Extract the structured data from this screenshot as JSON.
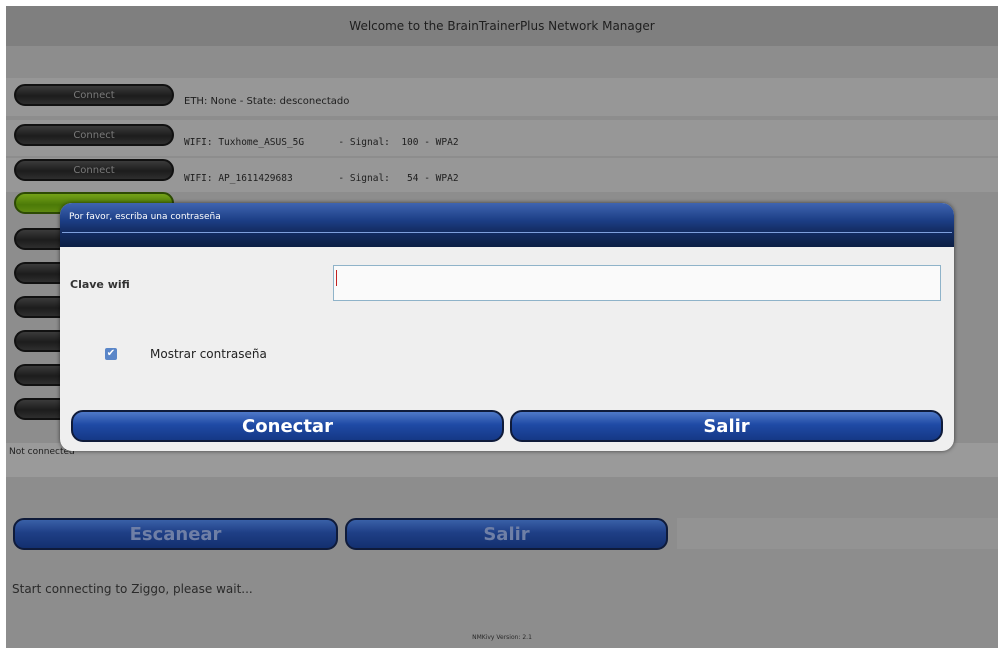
{
  "window": {
    "title": "Welcome to the BrainTrainerPlus Network Manager"
  },
  "networks": [
    {
      "button": "Connect",
      "info": "ETH: None - State: desconectado",
      "mono": false
    },
    {
      "button": "Connect",
      "info": "WIFI: Tuxhome_ASUS_5G      - Signal:  100 - WPA2",
      "mono": true
    },
    {
      "button": "Connect",
      "info": "WIFI: AP_1611429683        - Signal:   54 - WPA2",
      "mono": true
    }
  ],
  "status": "Not connected",
  "actions": {
    "scan_label": "Escanear",
    "exit_label": "Salir"
  },
  "message": "Start connecting to Ziggo, please wait...",
  "version": "NMKivy Version: 2.1",
  "dialog": {
    "title": "Por favor, escriba una contraseña",
    "field_label": "Clave wifi",
    "field_value": "",
    "show_password_label": "Mostrar contraseña",
    "show_password_checked": true,
    "connect_label": "Conectar",
    "exit_label": "Salir"
  },
  "colors": {
    "accent_blue": "#1f4aa5",
    "selected_green": "#5e8a10",
    "background": "#8d8d8d"
  }
}
